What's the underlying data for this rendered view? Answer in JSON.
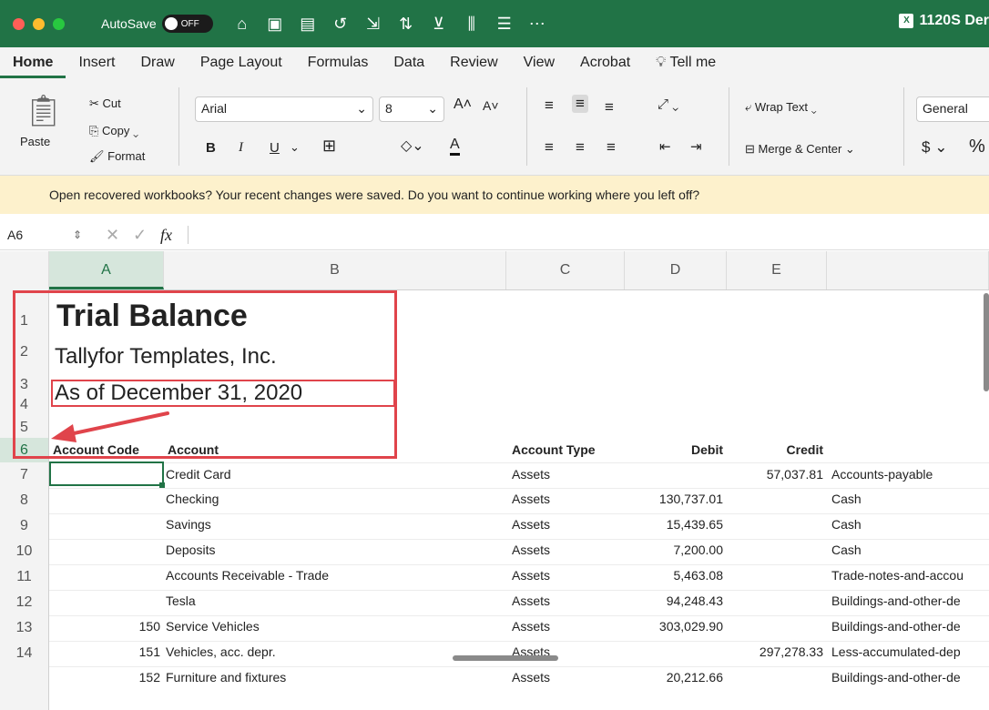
{
  "titlebar": {
    "autosave_label": "AutoSave",
    "autosave_state": "OFF",
    "doc_title": "1120S Der",
    "more": "⋯"
  },
  "tabs": [
    "Home",
    "Insert",
    "Draw",
    "Page Layout",
    "Formulas",
    "Data",
    "Review",
    "View",
    "Acrobat",
    "Tell me"
  ],
  "ribbon": {
    "paste": "Paste",
    "cut": "Cut",
    "copy": "Copy",
    "format": "Format",
    "font_name": "Arial",
    "font_size": "8",
    "bold": "B",
    "italic": "I",
    "underline": "U",
    "wrap_text": "Wrap Text",
    "merge_center": "Merge & Center",
    "number_format": "General",
    "currency": "$",
    "percent": "%"
  },
  "notice": "Open recovered workbooks?  Your recent changes were saved. Do you want to continue working where you left off?",
  "formula_bar": {
    "name_box": "A6",
    "fx": "fx",
    "value": ""
  },
  "columns": [
    "A",
    "B",
    "C",
    "D",
    "E"
  ],
  "rows": [
    "1",
    "2",
    "3",
    "4",
    "5",
    "6",
    "7",
    "8",
    "9",
    "10",
    "11",
    "12",
    "13",
    "14"
  ],
  "sheet": {
    "title": "Trial Balance",
    "company": "Tallyfor Templates, Inc.",
    "as_of": "As of December 31, 2020",
    "headers": {
      "code": "Account Code",
      "account": "Account",
      "type": "Account Type",
      "debit": "Debit",
      "credit": "Credit"
    },
    "data": [
      {
        "code": "",
        "account": "Credit Card",
        "type": "Assets",
        "debit": "",
        "credit": "57,037.81",
        "f": "Accounts-payable"
      },
      {
        "code": "",
        "account": "Checking",
        "type": "Assets",
        "debit": "130,737.01",
        "credit": "",
        "f": "Cash"
      },
      {
        "code": "",
        "account": "Savings",
        "type": "Assets",
        "debit": "15,439.65",
        "credit": "",
        "f": "Cash"
      },
      {
        "code": "",
        "account": "Deposits",
        "type": "Assets",
        "debit": "7,200.00",
        "credit": "",
        "f": "Cash"
      },
      {
        "code": "",
        "account": "Accounts Receivable - Trade",
        "type": "Assets",
        "debit": "5,463.08",
        "credit": "",
        "f": "Trade-notes-and-accou"
      },
      {
        "code": "",
        "account": "Tesla",
        "type": "Assets",
        "debit": "94,248.43",
        "credit": "",
        "f": "Buildings-and-other-de"
      },
      {
        "code": "150",
        "account": "Service Vehicles",
        "type": "Assets",
        "debit": "303,029.90",
        "credit": "",
        "f": "Buildings-and-other-de"
      },
      {
        "code": "151",
        "account": "Vehicles,  acc. depr.",
        "type": "Assets",
        "debit": "",
        "credit": "297,278.33",
        "f": "Less-accumulated-dep"
      },
      {
        "code": "152",
        "account": "Furniture and fixtures",
        "type": "Assets",
        "debit": "20,212.66",
        "credit": "",
        "f": "Buildings-and-other-de"
      }
    ]
  }
}
